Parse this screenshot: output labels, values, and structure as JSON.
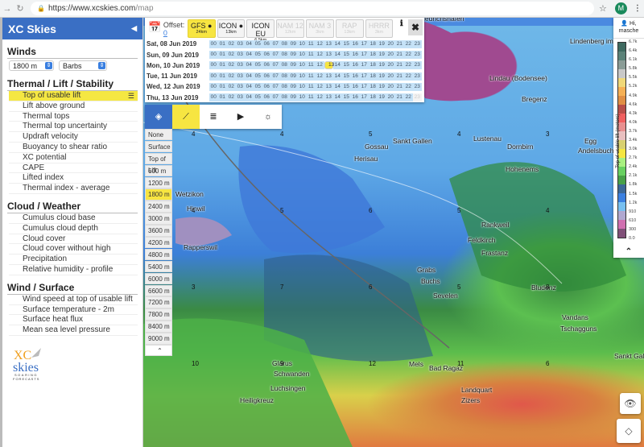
{
  "browser": {
    "url_host": "https://www.xcskies.com",
    "url_path": "/map",
    "avatar_letter": "M"
  },
  "sidebar": {
    "title": "XC Skies",
    "winds_heading": "Winds",
    "winds_altitude": "1800 m",
    "winds_style": "Barbs",
    "sections": [
      {
        "heading": "Thermal / Lift / Stability",
        "items": [
          "Top of usable lift",
          "Lift above ground",
          "Thermal tops",
          "Thermal top uncertainty",
          "Updraft velocity",
          "Buoyancy to shear ratio",
          "XC potential",
          "CAPE",
          "Lifted index",
          "Thermal index - average"
        ]
      },
      {
        "heading": "Cloud / Weather",
        "items": [
          "Cumulus cloud base",
          "Cumulus cloud depth",
          "Cloud cover",
          "Cloud cover without high",
          "Precipitation",
          "Relative humidity - profile"
        ]
      },
      {
        "heading": "Wind / Surface",
        "items": [
          "Wind speed at top of usable lift",
          "Surface temperature - 2m",
          "Surface heat flux",
          "Mean sea level pressure"
        ]
      }
    ],
    "active_item": "Top of usable lift",
    "logo": {
      "line1": "XC",
      "line2": "skies",
      "line3": "SOARING",
      "line4": "FORECASTS"
    }
  },
  "time_panel": {
    "offset_label": "Offset:",
    "offset_value": "0",
    "models": [
      {
        "name": "GFS",
        "res": "24km",
        "state": "selected",
        "icon": "globe-icon"
      },
      {
        "name": "ICON",
        "res": "13km",
        "state": "enabled",
        "icon": "globe-icon"
      },
      {
        "name": "ICON EU",
        "res": "6.5km",
        "state": "enabled"
      },
      {
        "name": "NAM 12",
        "res": "12km",
        "state": "disabled"
      },
      {
        "name": "NAM 3",
        "res": "3km",
        "state": "disabled"
      },
      {
        "name": "RAP",
        "res": "13km",
        "state": "disabled"
      },
      {
        "name": "HRRR",
        "res": "3km",
        "state": "disabled"
      }
    ],
    "days": [
      "Sat, 08 Jun 2019",
      "Sun, 09 Jun 2019",
      "Mon, 10 Jun 2019",
      "Tue, 11 Jun 2019",
      "Wed, 12 Jun 2019",
      "Thu, 13 Jun 2019"
    ],
    "hours": [
      "00",
      "01",
      "02",
      "03",
      "04",
      "05",
      "06",
      "07",
      "08",
      "09",
      "10",
      "11",
      "12",
      "13",
      "14",
      "15",
      "16",
      "17",
      "18",
      "19",
      "20",
      "21",
      "22",
      "23"
    ],
    "selected": {
      "day": "Mon, 10 Jun 2019",
      "hour": "13"
    },
    "unavailable": [
      {
        "day": "Thu, 13 Jun 2019",
        "hour": "23"
      }
    ]
  },
  "layer_toolbar": {
    "buttons": [
      "layers-icon",
      "wind-barb-icon",
      "stripes-icon",
      "play-icon",
      "sun-icon"
    ],
    "active": "wind-barb-icon"
  },
  "altitudes": {
    "options": [
      "None",
      "Surface",
      "Top of Lift",
      "600 m",
      "1200 m",
      "1800 m",
      "2400 m",
      "3000 m",
      "3600 m",
      "4200 m",
      "4800 m",
      "5400 m",
      "6000 m",
      "6600 m",
      "7200 m",
      "7800 m",
      "8400 m",
      "9000 m"
    ],
    "selected": "1800 m"
  },
  "user": {
    "greeting": "Hi,",
    "name": "masche"
  },
  "legend": {
    "title": "Top of usable lift (meters)",
    "ticks": [
      "6.7k",
      "6.4k",
      "6.1k",
      "5.8k",
      "5.5k",
      "5.2k",
      "4.9k",
      "4.6k",
      "4.3k",
      "4.0k",
      "3.7k",
      "3.4k",
      "3.0k",
      "2.7k",
      "2.4k",
      "2.1k",
      "1.8k",
      "1.5k",
      "1.2k",
      "910",
      "610",
      "300",
      "0.0"
    ],
    "colors": [
      "#3f6a60",
      "#5b8278",
      "#8a9c96",
      "#c8c8c8",
      "#f0d878",
      "#f5b055",
      "#e08f45",
      "#b84f4a",
      "#f06060",
      "#e89090",
      "#e8c0c0",
      "#d8d070",
      "#f5e640",
      "#a8f080",
      "#68d060",
      "#48a048",
      "#3c6898",
      "#3c80e0",
      "#78c0f0",
      "#b0a8d0",
      "#d070b0",
      "#805078"
    ]
  },
  "map": {
    "places": [
      "Friedrichshafen",
      "Lindenberg im Allgäu",
      "Lindau (Bodensee)",
      "Bregenz",
      "Sankt Gallen",
      "Gossau",
      "Herisau",
      "Lustenau",
      "Dornbirn",
      "Hohenems",
      "Egg",
      "Andelsbuch",
      "Wetzikon",
      "Hinwil",
      "Rapperswil",
      "Rankweil",
      "Feldkirch",
      "Frastanz",
      "Grabs",
      "Buchs",
      "Bludenz",
      "Vandans",
      "Tschagguns",
      "Glarus",
      "Schwanden",
      "Luchsingen",
      "Mels",
      "Bad Ragaz",
      "Landquart",
      "Zizers",
      "Sankt Gallenkirch",
      "Heiligkreuz",
      "Sevelen"
    ],
    "wind_speeds": [
      "4",
      "4",
      "5",
      "4",
      "3",
      "4",
      "5",
      "6",
      "5",
      "4",
      "3",
      "7",
      "6",
      "5",
      "8",
      "10",
      "9",
      "12",
      "11",
      "6"
    ]
  },
  "map_buttons": [
    "eye-icon",
    "layers-stack-icon"
  ]
}
